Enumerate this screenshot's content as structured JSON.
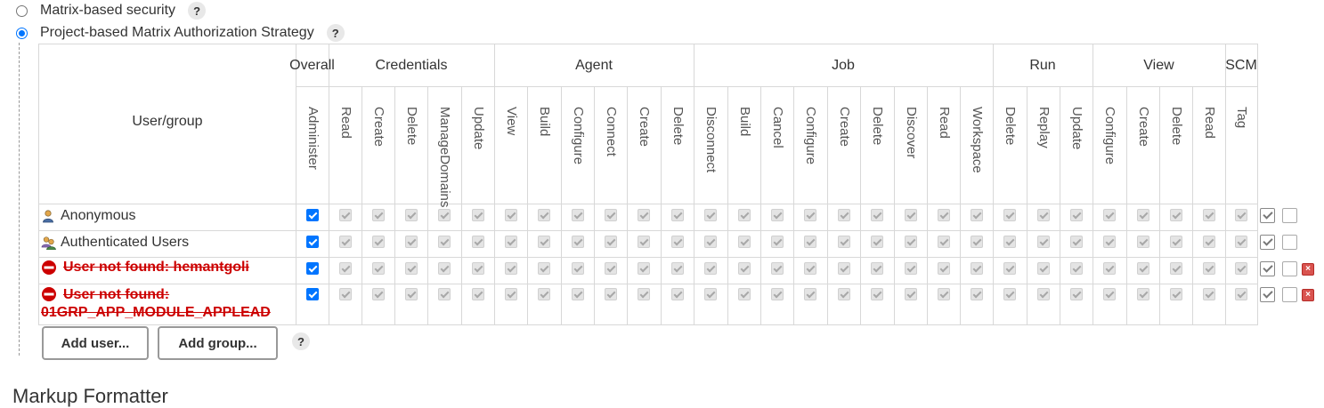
{
  "auth_options": {
    "matrix_based": {
      "label": "Matrix-based security",
      "selected": false
    },
    "project_based": {
      "label": "Project-based Matrix Authorization Strategy",
      "selected": true
    },
    "help": "?"
  },
  "matrix": {
    "user_group_header": "User/group",
    "categories": [
      "Overall",
      "Credentials",
      "Agent",
      "Job",
      "Run",
      "View",
      "SCM"
    ],
    "permissions": [
      "Administer",
      "Read",
      "Create",
      "Delete",
      "ManageDomains",
      "Update",
      "View",
      "Build",
      "Configure",
      "Connect",
      "Create",
      "Delete",
      "Disconnect",
      "Build",
      "Cancel",
      "Configure",
      "Create",
      "Delete",
      "Discover",
      "Read",
      "Workspace",
      "Delete",
      "Replay",
      "Update",
      "Configure",
      "Create",
      "Delete",
      "Read",
      "Tag"
    ],
    "rows": [
      {
        "label": "Anonymous",
        "type": "user",
        "not_found": false,
        "administer": true
      },
      {
        "label": "Authenticated Users",
        "type": "group",
        "not_found": false,
        "administer": true
      },
      {
        "label": "User not found: hemantgoli",
        "type": "missing",
        "not_found": true,
        "administer": true
      },
      {
        "label_line1": "User not found:",
        "label_line2": "01GRP_APP_MODULE_APPLEAD",
        "type": "missing",
        "not_found": true,
        "administer": true
      }
    ]
  },
  "buttons": {
    "add_user": "Add user...",
    "add_group": "Add group...",
    "help": "?"
  },
  "next_section_title": "Markup Formatter",
  "icons": {
    "user": "user-icon",
    "group": "group-icon",
    "not_found": "blocked-icon",
    "select_all": "check-all-icon",
    "unselect_all": "uncheck-all-icon",
    "remove": "remove-icon"
  },
  "colors": {
    "accent": "#0075ff",
    "error": "#cc0000"
  }
}
